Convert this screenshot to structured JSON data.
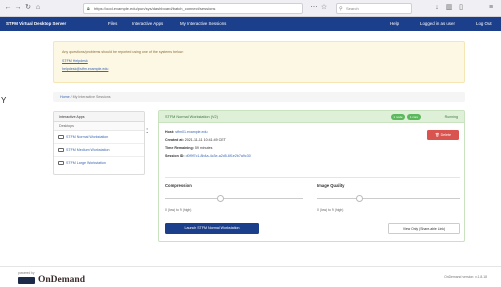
{
  "browser": {
    "url": "https://ood.example.edu/pun/sys/dashboard/batch_connect/sessions",
    "search_placeholder": "Search",
    "toolbar_icons": [
      "back-icon",
      "forward-icon",
      "reload-icon",
      "home-icon",
      "more-icon",
      "bookmark-icon",
      "download-icon",
      "library-icon",
      "sidebar-icon",
      "menu-icon"
    ]
  },
  "navbar": {
    "brand": "STFM Virtual Desktop Server",
    "menus": [
      "Files",
      "Interactive Apps",
      "My Interactive Sessions"
    ],
    "right": [
      "Help",
      "Logged in as user",
      "Log Out"
    ]
  },
  "alert": {
    "line1": "Any questions/problems should be reported using one of the systems below:",
    "link1": "STFM Helpdesk",
    "link2": "helpdesk@stfm.example.edu"
  },
  "breadcrumb": {
    "home": "Home",
    "sep": "/",
    "current": "My Interactive Sessions"
  },
  "sidebar": {
    "header": "Interactive Apps",
    "subheader": "Desktops",
    "items": [
      {
        "label": "STFM Normal Workstation"
      },
      {
        "label": "STFM Medium Workstation"
      },
      {
        "label": "STFM Large Workstation"
      }
    ]
  },
  "session": {
    "title": "STFM Normal Workstation (V2)",
    "badge1": "1 node",
    "badge2": "1 core",
    "status": "Running",
    "host_label": "Host:",
    "host_value": "stfm01.example.edu",
    "created_label": "Created at:",
    "created_value": "2021-11-11 10:41:49 CET",
    "time_label": "Time Remaining:",
    "time_value": "59 minutes",
    "session_label": "Session ID:",
    "session_value": "d0f9f7c1-8b4a-4c3e-a2d5-6f1e2b7a9c30",
    "delete_label": "Delete",
    "compression_label": "Compression",
    "compression_hint": "0 (low) to 9 (high)",
    "compression_level": 0.4,
    "quality_label": "Image Quality",
    "quality_hint": "0 (low) to 9 (high)",
    "quality_level": 0.3,
    "launch_label": "Launch STFM Normal Workstation",
    "view_only_label": "View Only (Share-able Link)"
  },
  "footer": {
    "powered_by": "powered by",
    "logo_text": "OnDemand",
    "version": "OnDemand version: v.1.8.18"
  },
  "margin": {
    "left_fragment": "Y",
    "colon": ":"
  },
  "colors": {
    "navbar": "#1c3f8b",
    "success": "#5cb85c",
    "danger": "#d9534f",
    "alert_bg": "#fcf8e3"
  }
}
